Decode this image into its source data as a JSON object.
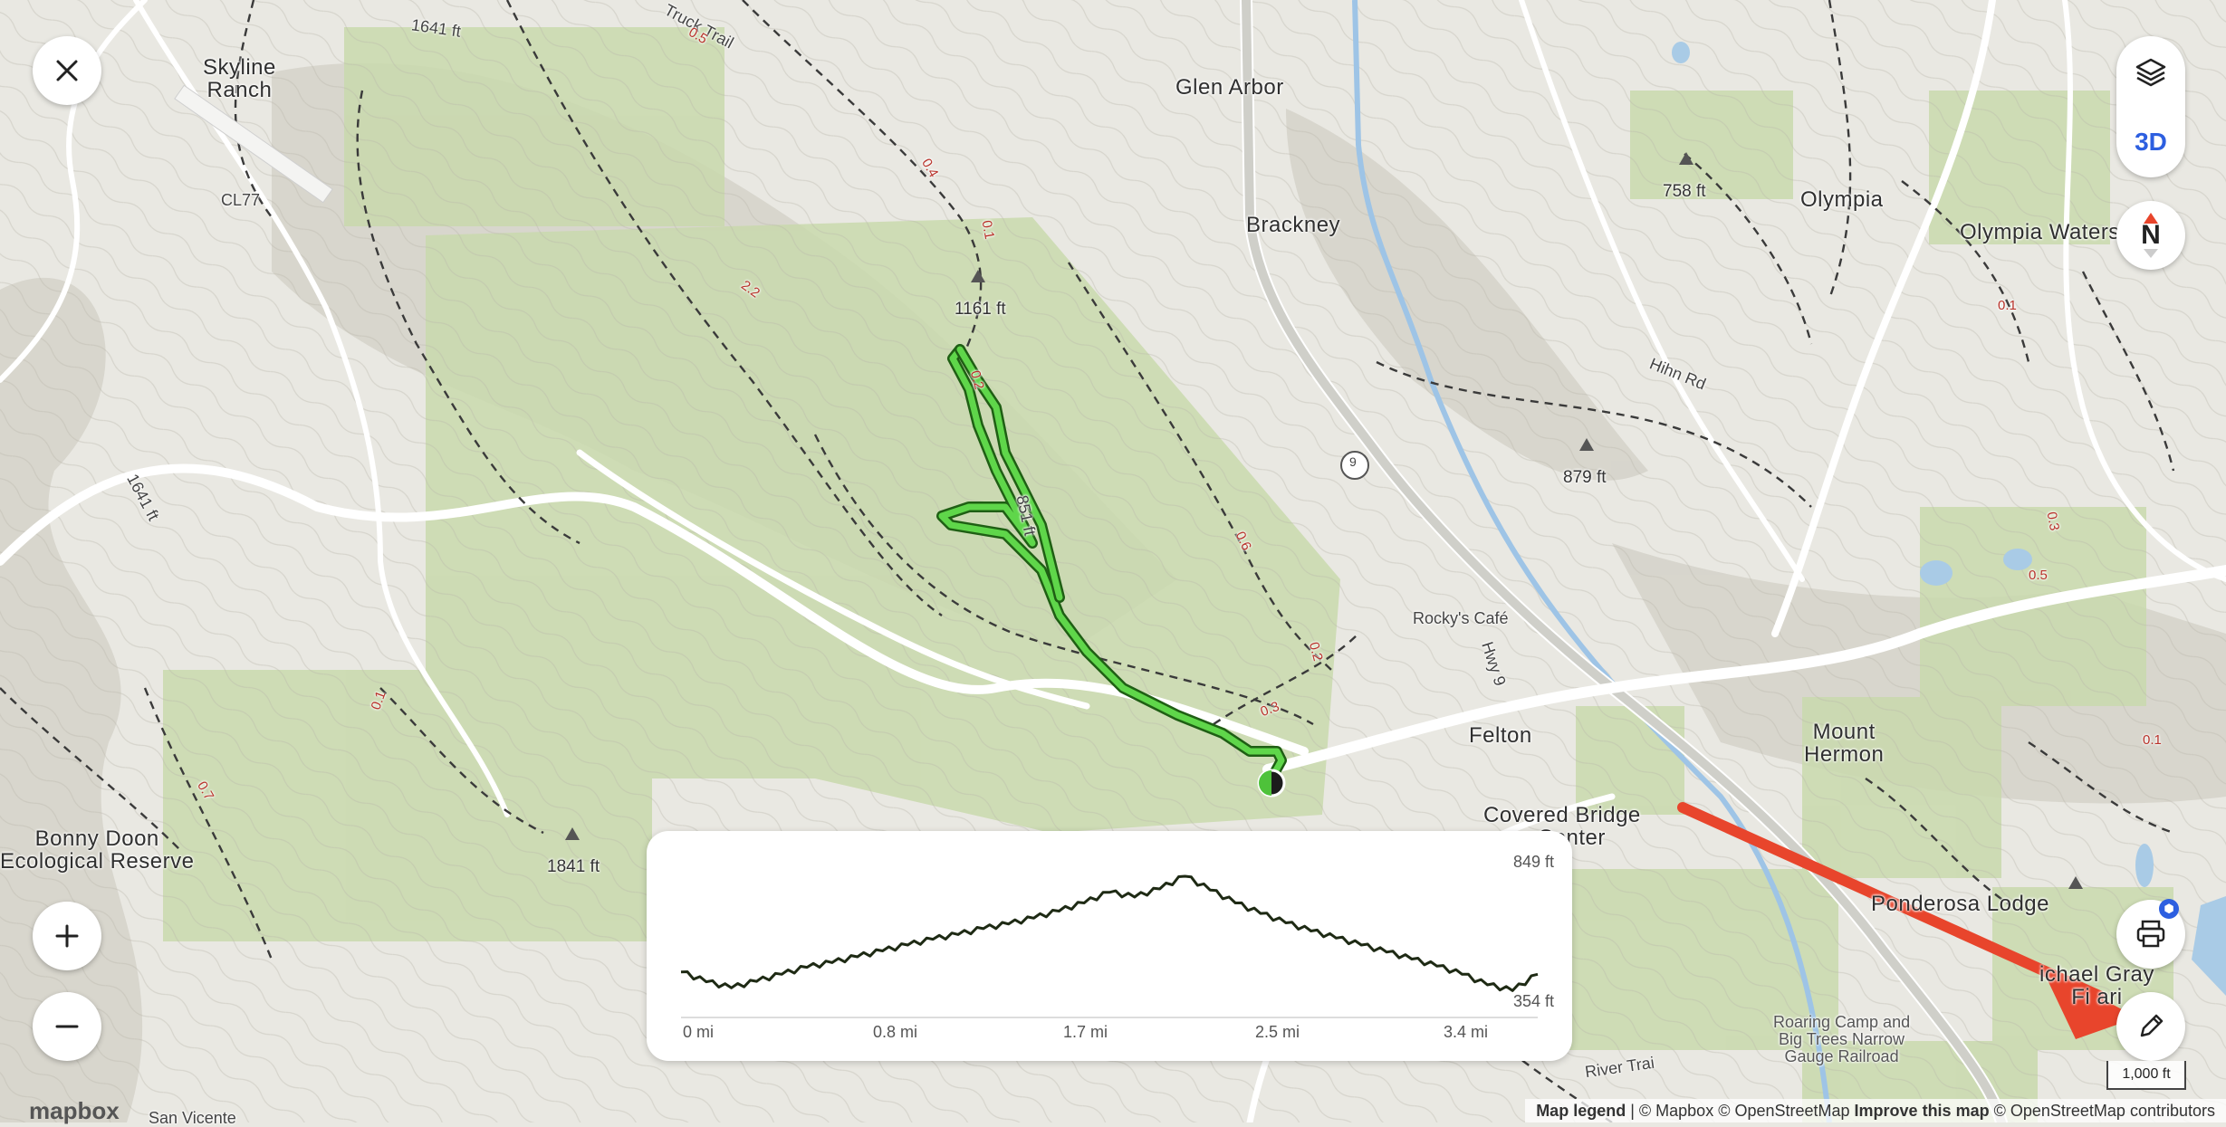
{
  "map": {
    "places": {
      "skyline_ranch": "Skyline\nRanch",
      "glen_arbor": "Glen Arbor",
      "brackney": "Brackney",
      "olympia": "Olympia",
      "olympia_waters": "Olympia Waters",
      "felton": "Felton",
      "mount_hermon": "Mount\nHermon",
      "bonny_doon": "Bonny Doon\nEcological Reserve",
      "covered_bridge": "Covered Bridge\nn Center",
      "ponderosa_lodge": "Ponderosa Lodge",
      "michael_gray": "ichael Gray\nFi   ari",
      "roaring_camp": "Roaring Camp and\nBig Trees Narrow\nGauge Railroad",
      "rockys_cafe": "Rocky's Café",
      "san_vicente": "San Vicente",
      "airport": "CL77"
    },
    "peaks": {
      "p1161": "1161 ft",
      "p758": "758 ft",
      "p879": "879 ft",
      "p1841": "1841 ft",
      "c1641a": "1641 ft",
      "c1641b": "1641 ft",
      "c851": "851 ft"
    },
    "roads": {
      "truck_trail": "Truck Trail",
      "hihn_rd": "Hihn Rd",
      "hwy9": "Hwy 9",
      "river_trail": "River Trai",
      "route9": "9"
    },
    "trail_distances": [
      "0.5",
      "0.4",
      "0.1",
      "2.2",
      "0.2",
      "0.6",
      "0.2",
      "0.3",
      "0.1",
      "0.7",
      "0.1",
      "0.3",
      "0.5",
      "0.1"
    ]
  },
  "controls": {
    "close_icon": "close-icon",
    "layers_icon": "layers-icon",
    "threed_label": "3D",
    "compass_label": "N",
    "zoom_in_icon": "plus-icon",
    "zoom_out_icon": "minus-icon",
    "print_icon": "printer-icon",
    "edit_icon": "pencil-icon",
    "badge_icon": "hex-icon"
  },
  "elevation": {
    "max_label": "849 ft",
    "min_label": "354 ft",
    "x_ticks": [
      "0 mi",
      "0.8 mi",
      "1.7 mi",
      "2.5 mi",
      "3.4 mi"
    ]
  },
  "chart_data": {
    "type": "area",
    "title": "",
    "xlabel": "",
    "ylabel": "",
    "x_unit": "mi",
    "y_unit": "ft",
    "ylim": [
      354,
      849
    ],
    "x": [
      0,
      0.1,
      0.2,
      0.3,
      0.4,
      0.5,
      0.6,
      0.7,
      0.8,
      0.9,
      1.0,
      1.1,
      1.2,
      1.3,
      1.4,
      1.5,
      1.6,
      1.7,
      1.8,
      1.9,
      2.0,
      2.1,
      2.2,
      2.3,
      2.4,
      2.5,
      2.6,
      2.7,
      2.8,
      2.9,
      3.0,
      3.1,
      3.2,
      3.3,
      3.4
    ],
    "y": [
      440,
      398,
      372,
      400,
      430,
      460,
      480,
      505,
      530,
      555,
      580,
      600,
      625,
      645,
      670,
      700,
      735,
      780,
      760,
      795,
      849,
      790,
      735,
      690,
      650,
      615,
      585,
      555,
      525,
      495,
      465,
      430,
      385,
      360,
      430
    ]
  },
  "scale": {
    "label": "1,000 ft"
  },
  "attribution": {
    "legend": "Map legend",
    "mapbox": "© Mapbox © OpenStreetMap",
    "improve": "Improve this map",
    "osm": "© OpenStreetMap contributors",
    "logo": "mapbox"
  },
  "colors": {
    "trail": "#3fa82b",
    "forest": "#c9d9ad",
    "annotation_arrow": "#e8452c",
    "accent": "#2d5fe0"
  }
}
